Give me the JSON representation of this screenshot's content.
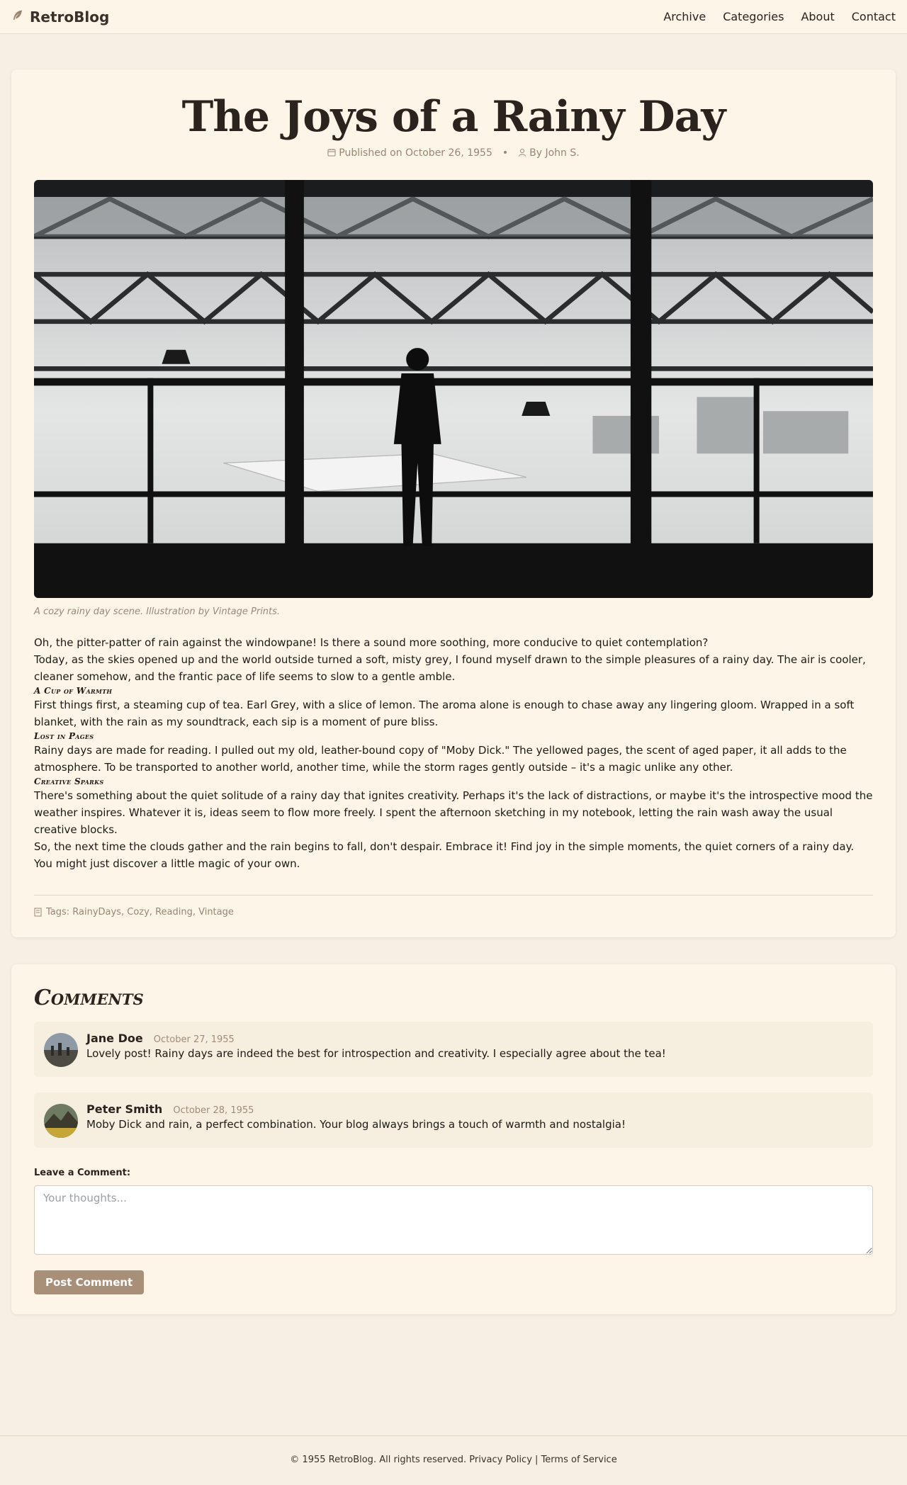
{
  "brand": {
    "name": "RetroBlog",
    "icon": "feather-icon"
  },
  "nav": {
    "archive": "Archive",
    "categories": "Categories",
    "about": "About",
    "contact": "Contact"
  },
  "post": {
    "title": "The Joys of a Rainy Day",
    "published": "Published on October 26, 1955",
    "separator": "•",
    "author": "By John S.",
    "caption": "A cozy rainy day scene. Illustration by Vintage Prints.",
    "p1": "Oh, the pitter-patter of rain against the windowpane! Is there a sound more soothing, more conducive to quiet contemplation?",
    "p2": "Today, as the skies opened up and the world outside turned a soft, misty grey, I found myself drawn to the simple pleasures of a rainy day. The air is cooler, cleaner somehow, and the frantic pace of life seems to slow to a gentle amble.",
    "h1": "A Cup of Warmth",
    "p3": "First things first, a steaming cup of tea. Earl Grey, with a slice of lemon. The aroma alone is enough to chase away any lingering gloom. Wrapped in a soft blanket, with the rain as my soundtrack, each sip is a moment of pure bliss.",
    "h2": "Lost in Pages",
    "p4": "Rainy days are made for reading. I pulled out my old, leather-bound copy of \"Moby Dick.\" The yellowed pages, the scent of aged paper, it all adds to the atmosphere. To be transported to another world, another time, while the storm rages gently outside – it's a magic unlike any other.",
    "h3": "Creative Sparks",
    "p5": "There's something about the quiet solitude of a rainy day that ignites creativity. Perhaps it's the lack of distractions, or maybe it's the introspective mood the weather inspires. Whatever it is, ideas seem to flow more freely. I spent the afternoon sketching in my notebook, letting the rain wash away the usual creative blocks.",
    "p6": "So, the next time the clouds gather and the rain begins to fall, don't despair. Embrace it! Find joy in the simple moments, the quiet corners of a rainy day. You might just discover a little magic of your own.",
    "tags": "Tags: RainyDays, Cozy, Reading, Vintage"
  },
  "comments": {
    "title": "Comments",
    "items": [
      {
        "name": "Jane Doe",
        "date": "October 27, 1955",
        "text": "Lovely post! Rainy days are indeed the best for introspection and creativity. I especially agree about the tea!"
      },
      {
        "name": "Peter Smith",
        "date": "October 28, 1955",
        "text": "Moby Dick and rain, a perfect combination. Your blog always brings a touch of warmth and nostalgia!"
      }
    ],
    "leave_label": "Leave a Comment:",
    "placeholder": "Your thoughts...",
    "post_button": "Post Comment"
  },
  "footer": {
    "copyright": "© 1955 RetroBlog. All rights reserved.",
    "privacy": "Privacy Policy",
    "divider": "|",
    "terms": "Terms of Service"
  },
  "colors": {
    "accent": "#a88f78",
    "background": "#f7efe3",
    "card": "#fcf5e8"
  }
}
